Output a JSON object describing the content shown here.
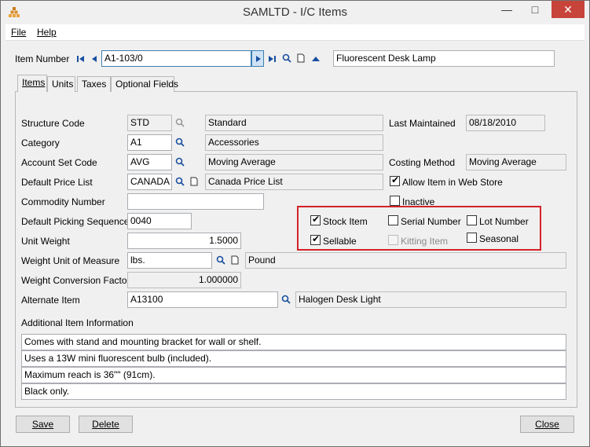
{
  "window": {
    "title": "SAMLTD - I/C Items"
  },
  "menu": {
    "file": "File",
    "help": "Help"
  },
  "item_number": {
    "label": "Item Number",
    "value": "A1-103/0",
    "description": "Fluorescent Desk Lamp"
  },
  "tabs": [
    "Items",
    "Units",
    "Taxes",
    "Optional Fields"
  ],
  "fields": {
    "structure_code": {
      "label": "Structure Code",
      "value": "STD",
      "description": "Standard"
    },
    "category": {
      "label": "Category",
      "value": "A1",
      "description": "Accessories"
    },
    "account_set": {
      "label": "Account Set Code",
      "value": "AVG",
      "description": "Moving Average"
    },
    "default_price_list": {
      "label": "Default Price List",
      "value": "CANADA",
      "description": "Canada Price List"
    },
    "commodity_number": {
      "label": "Commodity Number",
      "value": ""
    },
    "picking_sequence": {
      "label": "Default Picking Sequence",
      "value": "0040"
    },
    "unit_weight": {
      "label": "Unit Weight",
      "value": "1.5000"
    },
    "weight_uom": {
      "label": "Weight Unit of Measure",
      "value": "lbs.",
      "description": "Pound"
    },
    "weight_conversion": {
      "label": "Weight Conversion Factor",
      "value": "1.000000"
    },
    "alternate_item": {
      "label": "Alternate Item",
      "value": "A13100",
      "description": "Halogen Desk Light"
    },
    "last_maintained": {
      "label": "Last Maintained",
      "value": "08/18/2010"
    },
    "costing_method": {
      "label": "Costing Method",
      "value": "Moving Average"
    }
  },
  "checkboxes": {
    "allow_web_store": {
      "label": "Allow Item in Web Store",
      "checked": true
    },
    "inactive": {
      "label": "Inactive",
      "checked": false
    },
    "stock_item": {
      "label": "Stock Item",
      "checked": true
    },
    "serial_number": {
      "label": "Serial Number",
      "checked": false
    },
    "lot_number": {
      "label": "Lot Number",
      "checked": false
    },
    "sellable": {
      "label": "Sellable",
      "checked": true
    },
    "kitting_item": {
      "label": "Kitting Item",
      "checked": false,
      "disabled": true
    },
    "seasonal": {
      "label": "Seasonal",
      "checked": false
    }
  },
  "additional_info": {
    "label": "Additional Item Information",
    "lines": [
      "Comes with stand and mounting bracket for wall or shelf.",
      "Uses a 13W mini fluorescent bulb (included).",
      "Maximum reach is 36\"\" (91cm).",
      "Black only."
    ]
  },
  "buttons": {
    "save": "Save",
    "delete": "Delete",
    "close": "Close"
  },
  "colors": {
    "highlight_box": "#d3222a",
    "focus_border": "#3c7fb1"
  }
}
